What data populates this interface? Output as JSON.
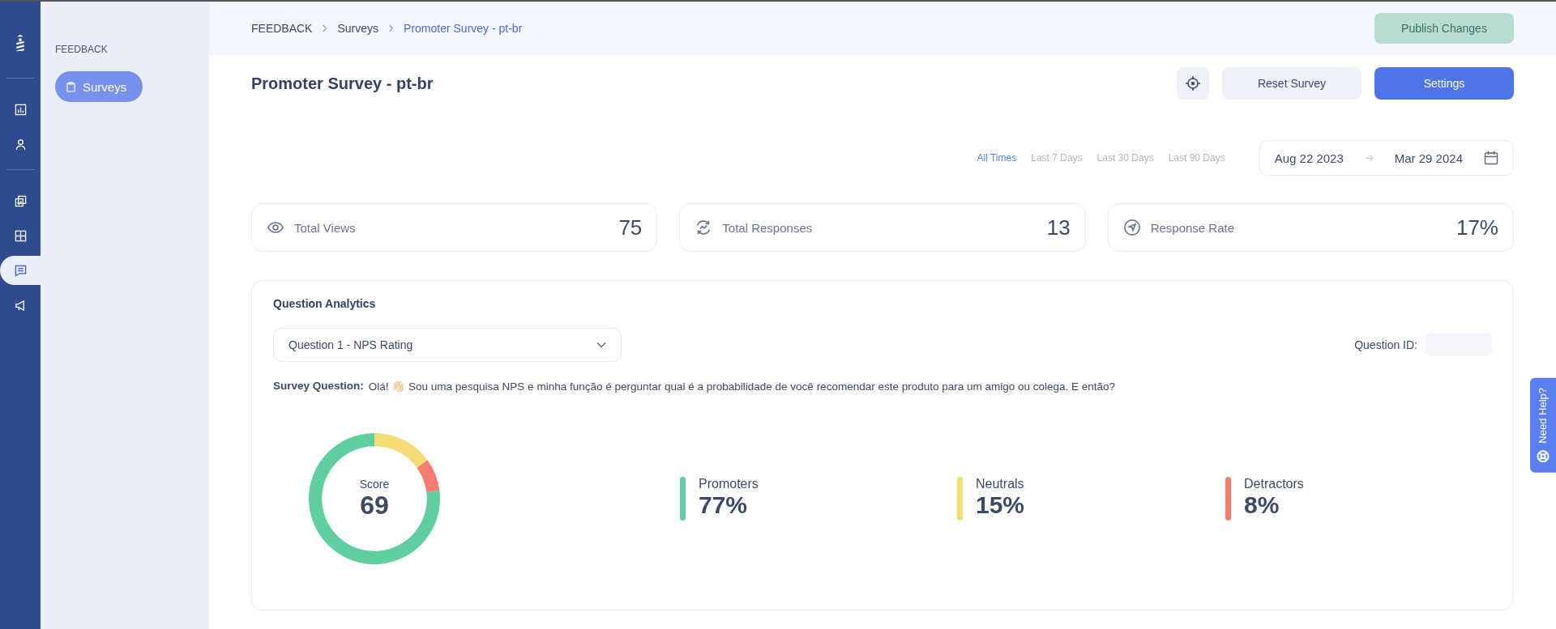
{
  "rail": [
    {
      "selected": false
    },
    {
      "selected": false
    },
    {
      "selected": false
    },
    {
      "selected": false
    },
    {
      "selected": true
    },
    {
      "selected": false
    }
  ],
  "sidebar": {
    "title": "FEEDBACK",
    "items": [
      {
        "label": "Surveys",
        "selected": true
      }
    ]
  },
  "breadcrumb": [
    "FEEDBACK",
    "Surveys",
    "Promoter Survey - pt-br"
  ],
  "publish_button": {
    "label": "Publish Changes",
    "disabled": true
  },
  "page_title": "Promoter Survey - pt-br",
  "buttons": [
    "Reset Survey",
    "Settings"
  ],
  "date_filters": [
    {
      "label": "All Times",
      "selected": true
    },
    {
      "label": "Last 7 Days",
      "selected": false
    },
    {
      "label": "Last 30 Days",
      "selected": false
    },
    {
      "label": "Last 90 Days",
      "selected": false
    }
  ],
  "date_range": {
    "start": "Aug 22 2023",
    "end": "Mar 29 2024"
  },
  "stats": [
    {
      "label": "Total Views",
      "value": "75"
    },
    {
      "label": "Total Responses",
      "value": "13"
    },
    {
      "label": "Response Rate",
      "value": "17%"
    }
  ],
  "analytics": {
    "title": "Question Analytics",
    "question_select": "Question 1 - NPS Rating",
    "question_id_label": "Question ID:",
    "survey_question_label": "Survey Question:",
    "survey_question": "Olá! 👋🏻 Sou uma pesquisa NPS e minha função é perguntar qual é a probabilidade de você recomendar este produto para um amigo ou colega. E então?",
    "score_label": "Score",
    "score": "69",
    "chart_data": {
      "type": "donut",
      "categories": [
        "Promoters",
        "Neutrals",
        "Detractors"
      ],
      "values": [
        77,
        15,
        8
      ]
    },
    "legend": [
      {
        "value": "77%",
        "color": "#5fcfa0"
      },
      {
        "value": "15%",
        "color": "#f5dc74"
      },
      {
        "value": "8%",
        "color": "#f87b72"
      }
    ]
  },
  "help_tab": "Need Help?"
}
